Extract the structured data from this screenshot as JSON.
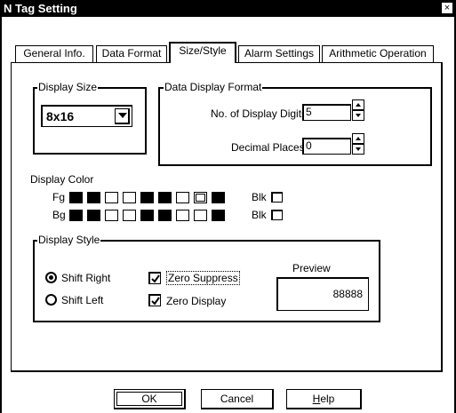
{
  "window": {
    "title": "N Tag Setting",
    "close_glyph": "×"
  },
  "tabs": [
    {
      "label": "General Info."
    },
    {
      "label": "Data Format"
    },
    {
      "label": "Size/Style",
      "active": true
    },
    {
      "label": "Alarm Settings"
    },
    {
      "label": "Arithmetic Operation"
    }
  ],
  "display_size": {
    "group_label": "Display Size",
    "value": "8x16"
  },
  "data_display_format": {
    "group_label": "Data Display Format",
    "digits_label": "No. of Display Digits",
    "digits_value": "5",
    "decimal_label": "Decimal Places",
    "decimal_value": "0"
  },
  "display_color": {
    "label": "Display Color",
    "fg_label": "Fg",
    "bg_label": "Bg",
    "blink_label": "Blk",
    "fg_swatches": [
      "black",
      "black",
      "white",
      "white",
      "black",
      "black",
      "white",
      "selected",
      "black"
    ],
    "bg_swatches": [
      "black",
      "black",
      "white",
      "white",
      "black",
      "black",
      "white",
      "white",
      "black"
    ]
  },
  "display_style": {
    "group_label": "Display Style",
    "shift_right": "Shift Right",
    "shift_left": "Shift Left",
    "selected_shift": "Shift Right",
    "zero_suppress": "Zero Suppress",
    "zero_suppress_checked": true,
    "zero_display": "Zero Display",
    "zero_display_checked": true,
    "preview_label": "Preview",
    "preview_value": "88888"
  },
  "buttons": {
    "ok": "OK",
    "cancel": "Cancel",
    "help": "Help"
  }
}
